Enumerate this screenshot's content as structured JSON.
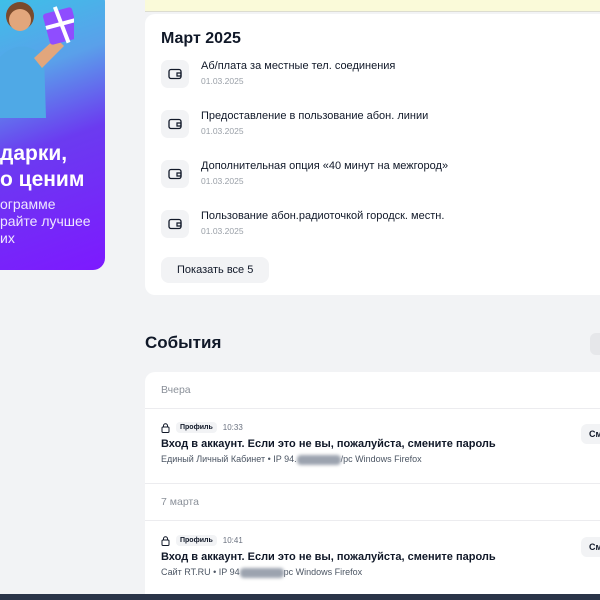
{
  "promo": {
    "line1": "дарки,",
    "line2": "о ценим",
    "line3": "ограмме",
    "line4": "райте лучшее",
    "line5": "их"
  },
  "payments": {
    "month": "Март 2025",
    "items": [
      {
        "title": "Аб/плата за местные тел. соединения",
        "date": "01.03.2025",
        "icon": "wallet-icon"
      },
      {
        "title": "Предоставление в пользование абон. линии",
        "date": "01.03.2025",
        "icon": "wallet-icon"
      },
      {
        "title": "Дополнительная опция «40 минут на межгород»",
        "date": "01.03.2025",
        "icon": "wallet-icon"
      },
      {
        "title": "Пользование абон.радиоточкой городск. местн.",
        "date": "01.03.2025",
        "icon": "wallet-icon"
      }
    ],
    "show_all": "Показать все 5"
  },
  "events": {
    "title": "События",
    "groups": [
      {
        "day": "Вчера",
        "badge": "Профиль",
        "time": "10:33",
        "title": "Вход в аккаунт. Если это не вы, пожалуйста, смените пароль",
        "source": "Единый Личный Кабинет",
        "ip_prefix": "IP 94.",
        "ip_suffix": "/pc Windows Firefox",
        "action": "См"
      },
      {
        "day": "7 марта",
        "badge": "Профиль",
        "time": "10:41",
        "title": "Вход в аккаунт. Если это не вы, пожалуйста, смените пароль",
        "source": "Сайт RT.RU",
        "ip_prefix": "IP 94",
        "ip_suffix": "pc Windows Firefox",
        "action": "См"
      }
    ]
  },
  "colors": {
    "promo_start": "#38c6e8",
    "promo_end": "#7d19ff",
    "background": "#f2f3f5",
    "card": "#ffffff"
  }
}
